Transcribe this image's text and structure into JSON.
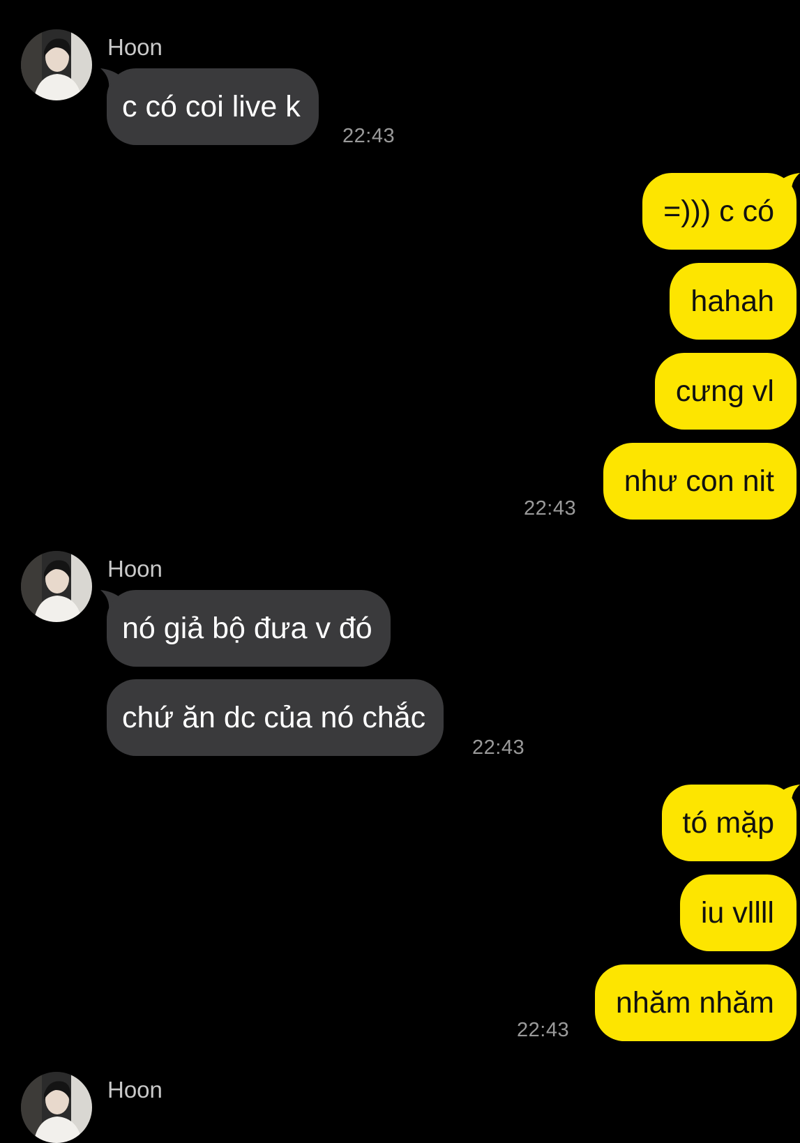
{
  "colors": {
    "background": "#000000",
    "incoming_bubble": "#3a3a3c",
    "outgoing_bubble": "#fde500",
    "incoming_text": "#ffffff",
    "outgoing_text": "#111111",
    "timestamp": "#9a9a9a",
    "sender_name": "#c9c9c9"
  },
  "messages": [
    {
      "direction": "incoming",
      "sender": "Hoon",
      "avatar_icon": "profile-photo-avatar",
      "bubbles": [
        "c có coi live k"
      ],
      "time": "22:43"
    },
    {
      "direction": "outgoing",
      "bubbles": [
        "=))) c có",
        "hahah",
        "cưng vl",
        "như con nit"
      ],
      "time": "22:43"
    },
    {
      "direction": "incoming",
      "sender": "Hoon",
      "avatar_icon": "profile-photo-avatar",
      "bubbles": [
        "nó giả bộ đưa v đó",
        "chứ ăn dc của nó chắc"
      ],
      "time": "22:43"
    },
    {
      "direction": "outgoing",
      "bubbles": [
        "tó mặp",
        "iu vllll",
        "nhăm nhăm"
      ],
      "time": "22:43"
    },
    {
      "direction": "incoming",
      "sender": "Hoon",
      "avatar_icon": "profile-photo-avatar",
      "bubbles": [],
      "time": ""
    }
  ]
}
